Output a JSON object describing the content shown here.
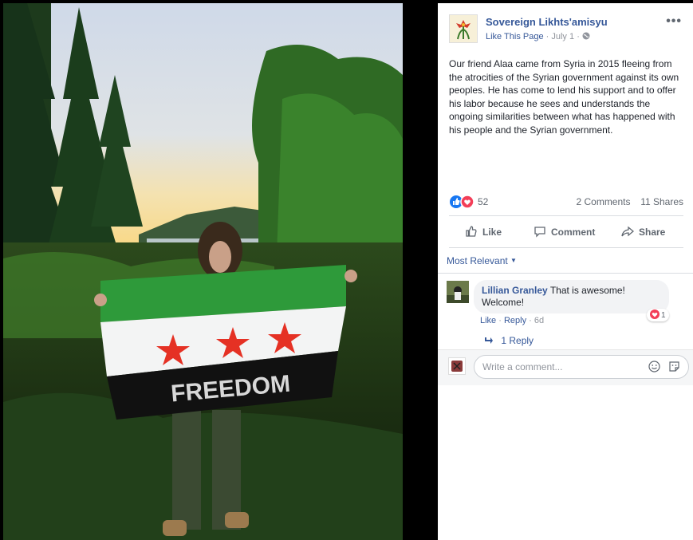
{
  "post": {
    "page_name": "Sovereign Likhts'amisyu",
    "like_page": "Like This Page",
    "date": "July 1",
    "text": "Our friend Alaa came from Syria in 2015 fleeing from the atrocities of the Syrian government against its own peoples. He has come to lend his support and to offer his labor because he sees and understands the ongoing similarities between what has happened with his people and the Syrian government.",
    "reaction_count": "52",
    "comments_count": "2 Comments",
    "shares_count": "11 Shares"
  },
  "photo": {
    "flag_text": "FREEDOM"
  },
  "actions": {
    "like": "Like",
    "comment": "Comment",
    "share": "Share"
  },
  "comments": {
    "sort_label": "Most Relevant",
    "items": [
      {
        "author": "Lillian Granley",
        "text": "That is awesome! Welcome!",
        "like": "Like",
        "reply": "Reply",
        "time": "6d",
        "reaction_count": "1"
      }
    ],
    "replies_link": "1 Reply",
    "write_placeholder": "Write a comment..."
  },
  "colors": {
    "link_blue": "#365899",
    "like_blue": "#1877f2",
    "love_red": "#f33e58"
  },
  "icons": [
    "globe-icon",
    "more-dots-icon",
    "like-reaction-icon",
    "love-reaction-icon",
    "thumbs-up-icon",
    "comment-bubble-icon",
    "share-arrow-icon",
    "caret-down-icon",
    "reply-arrow-icon",
    "smiley-icon",
    "sticker-icon"
  ]
}
